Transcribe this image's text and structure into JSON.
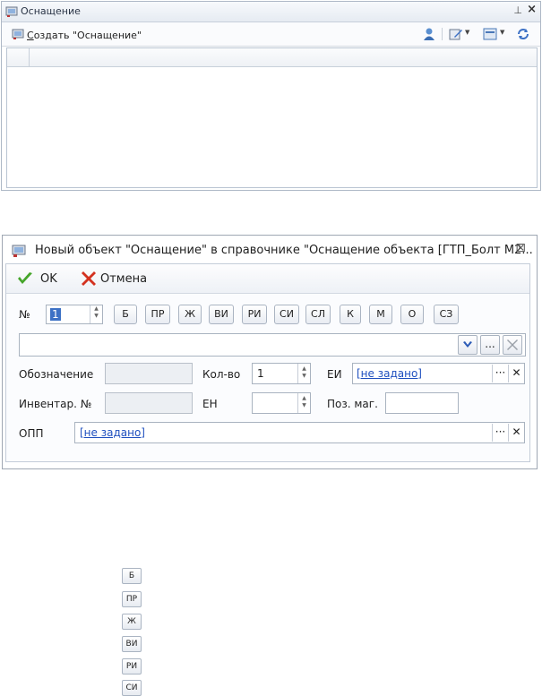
{
  "panel": {
    "title": "Оснащение",
    "pin_glyph": "⊥",
    "close_glyph": "×",
    "create_prefix": "С",
    "create_rest": "оздать \"Оснащение\""
  },
  "dialog": {
    "title": "Новый объект \"Оснащение\" в справочнике \"Оснащение объекта [ГТП_Болт М2...",
    "close_glyph": "⊠",
    "ok_label": "OK",
    "cancel_label": "Отмена",
    "number_label": "№",
    "number_value": "1",
    "chips": [
      "Б",
      "ПР",
      "Ж",
      "ВИ",
      "РИ",
      "СИ",
      "СЛ",
      "К",
      "М",
      "О",
      "СЗ"
    ],
    "ellipsis": "...",
    "designation_label": "Обозначение",
    "inventory_label": "Инвентар. №",
    "qty_label": "Кол-во",
    "qty_value": "1",
    "ei_label": "ЕИ",
    "ei_value": "[не задано]",
    "en_label": "ЕН",
    "pos_label": "Поз. маг.",
    "opp_label": "ОПП",
    "opp_value": "[не задано]",
    "dots": "···",
    "clear": "✕"
  },
  "bottom_chips": [
    "Б",
    "ПР",
    "Ж",
    "ВИ",
    "РИ",
    "СИ"
  ],
  "colors": {
    "accent": "#3d71c5",
    "link": "#1f4fbf",
    "border": "#a9b3c0"
  }
}
